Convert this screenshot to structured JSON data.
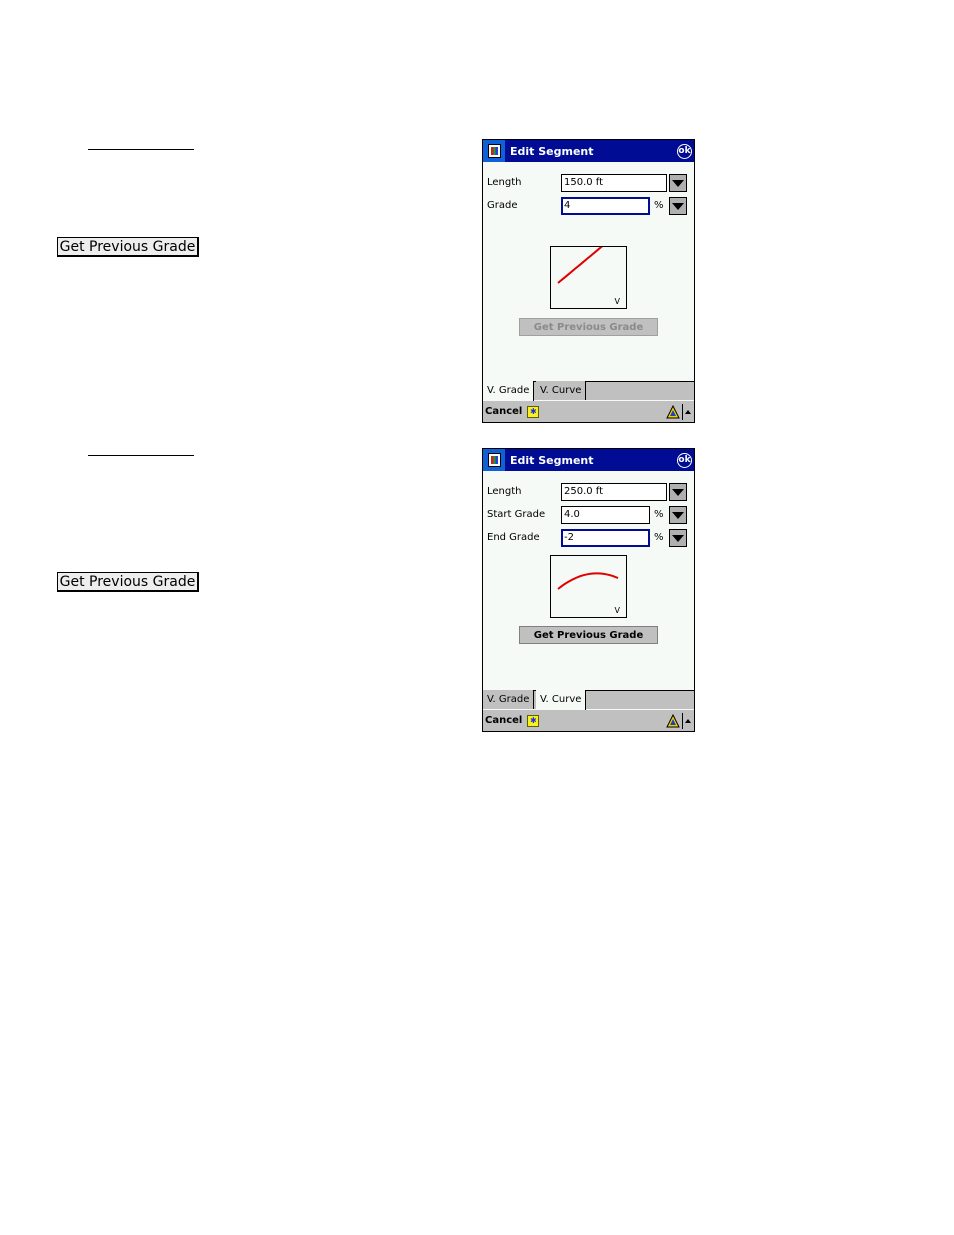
{
  "document": {
    "left_button_label": "Get Previous Grade"
  },
  "screens": [
    {
      "title": "Edit Segment",
      "ok_label": "ok",
      "fields": [
        {
          "label": "Length",
          "value": "150.0 ft",
          "unit": ""
        },
        {
          "label": "Grade",
          "value": "4",
          "unit": "%"
        }
      ],
      "preview_marker": "V",
      "preview_profile": {
        "type": "grade",
        "grades_percent": [
          4
        ]
      },
      "button_label": "Get Previous Grade",
      "button_enabled": false,
      "tabs": [
        {
          "label": "V. Grade",
          "active": true
        },
        {
          "label": "V. Curve",
          "active": false
        }
      ],
      "cancel_label": "Cancel"
    },
    {
      "title": "Edit Segment",
      "ok_label": "ok",
      "fields": [
        {
          "label": "Length",
          "value": "250.0 ft",
          "unit": ""
        },
        {
          "label": "Start Grade",
          "value": "4.0",
          "unit": "%"
        },
        {
          "label": "End Grade",
          "value": "-2",
          "unit": "%"
        }
      ],
      "preview_marker": "V",
      "preview_profile": {
        "type": "curve",
        "grades_percent": [
          4,
          -2
        ]
      },
      "button_label": "Get Previous Grade",
      "button_enabled": true,
      "tabs": [
        {
          "label": "V. Grade",
          "active": false
        },
        {
          "label": "V. Curve",
          "active": true
        }
      ],
      "cancel_label": "Cancel"
    }
  ],
  "colors": {
    "titlebar": "#000c94",
    "profile_line": "#e00000",
    "screen_bg": "#f5faf6"
  }
}
